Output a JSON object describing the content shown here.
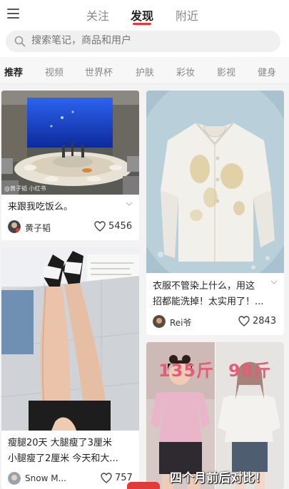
{
  "header": {
    "tabs": [
      {
        "label": "关注"
      },
      {
        "label": "发现"
      },
      {
        "label": "附近"
      }
    ],
    "active_tab": "发现"
  },
  "search": {
    "placeholder": "搜索笔记，商品和用户"
  },
  "categories": [
    {
      "label": "推荐"
    },
    {
      "label": "视频"
    },
    {
      "label": "世界杯"
    },
    {
      "label": "护肤"
    },
    {
      "label": "彩妆"
    },
    {
      "label": "影视"
    },
    {
      "label": "健身"
    }
  ],
  "feed": [
    {
      "title": "来跟我吃饭么。",
      "author": "黄子韬",
      "likes": "5456",
      "watermark": "@黄子韬 小红书"
    },
    {
      "title_line1": "衣服不管染上什么，用这",
      "title_line2": "招都能洗掉！太实用了！...",
      "author": "Rei爷",
      "likes": "2843"
    },
    {
      "title_line1": "瘦腿20天 大腿瘦了3厘米",
      "title_line2": "小腿瘦了2厘米 今天和大...",
      "author": "Snow M...",
      "likes": "757"
    },
    {
      "overlay_left": "135斤",
      "overlay_right": "98斤",
      "overlay_bottom": "四个月前后对比！"
    }
  ],
  "colors": {
    "accent": "#e53935",
    "background": "#f3f3f3"
  }
}
